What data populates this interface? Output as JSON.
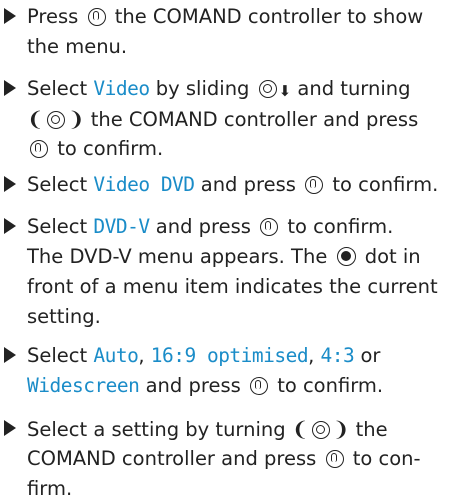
{
  "steps": [
    {
      "lines": [
        {
          "a": "Press",
          "b": "the COMAND controller to show"
        },
        {
          "a": "the menu."
        }
      ]
    },
    {
      "lines": [
        {
          "a": "Select",
          "key1": "Video",
          "b": "by sliding",
          "c": "and turning"
        },
        {
          "b": "the COMAND controller and press"
        },
        {
          "b": "to confirm."
        }
      ]
    },
    {
      "lines": [
        {
          "a": "Select",
          "key1": "Video DVD",
          "b": "and press",
          "c": "to confirm."
        }
      ]
    },
    {
      "lines": [
        {
          "a": "Select",
          "key1": "DVD-V",
          "b": "and press",
          "c": "to confirm."
        },
        {
          "a": "The DVD-V menu appears. The",
          "b": "dot in"
        },
        {
          "a": "front of a menu item indicates the current"
        },
        {
          "a": "setting."
        }
      ]
    },
    {
      "lines": [
        {
          "a": "Select",
          "key1": "Auto",
          "sep1": ",",
          "key2": "16:9 optimised",
          "sep2": ",",
          "key3": "4:3",
          "sep3": "or"
        },
        {
          "key1": "Widescreen",
          "b": "and press",
          "c": "to confirm."
        }
      ]
    },
    {
      "lines": [
        {
          "a": "Select a setting by turning",
          "b": "the"
        },
        {
          "a": "COMAND controller and press",
          "b": "to con-"
        },
        {
          "a": "firm."
        }
      ]
    }
  ],
  "icons": {
    "bullet": "triangle-bullet-icon",
    "press": "controller-press-icon",
    "slide": "controller-slide-down-icon",
    "turn": "controller-turn-icon",
    "dot": "filled-radio-dot-icon"
  }
}
